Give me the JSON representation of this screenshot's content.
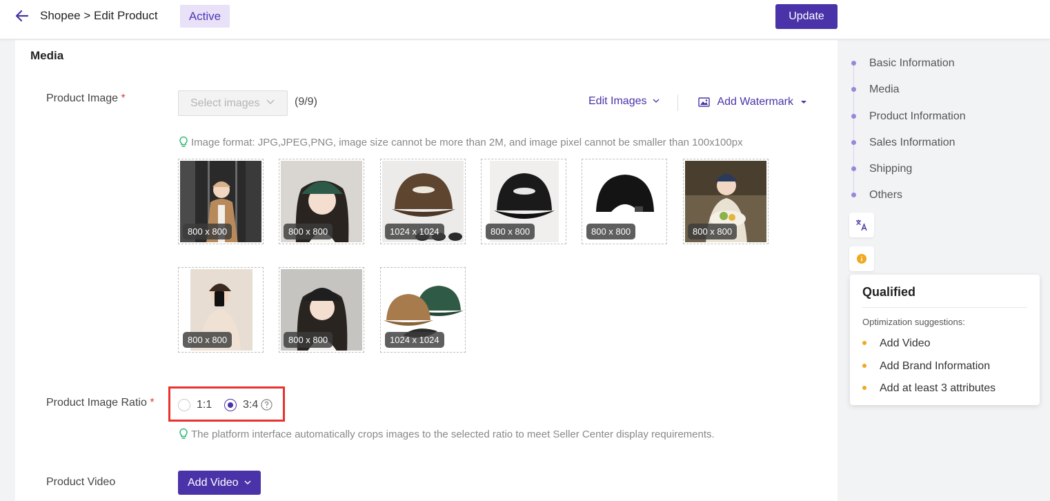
{
  "header": {
    "breadcrumb": "Shopee > Edit Product",
    "status": "Active",
    "update_label": "Update"
  },
  "media": {
    "section_title": "Media",
    "product_image_label": "Product Image",
    "required_mark": "*",
    "select_images_placeholder": "Select images",
    "image_count": "(9/9)",
    "edit_images_label": "Edit Images",
    "add_watermark_label": "Add Watermark",
    "format_hint": "Image format: JPG,JPEG,PNG, image size cannot be more than 2M, and image pixel cannot be smaller than 100x100px",
    "images": [
      {
        "size": "800 x 800",
        "subject": "woman-in-cap-mirror-selfie"
      },
      {
        "size": "800 x 800",
        "subject": "woman-in-green-cap"
      },
      {
        "size": "1024 x 1024",
        "subject": "brown-cap-product"
      },
      {
        "size": "800 x 800",
        "subject": "black-cap-front"
      },
      {
        "size": "800 x 800",
        "subject": "black-cap-back"
      },
      {
        "size": "800 x 800",
        "subject": "woman-in-navy-cap-eating"
      },
      {
        "size": "800 x 800",
        "subject": "person-in-cap-selfie"
      },
      {
        "size": "800 x 800",
        "subject": "woman-in-black-cap"
      },
      {
        "size": "1024 x 1024",
        "subject": "green-and-tan-caps"
      }
    ],
    "ratio_label": "Product Image Ratio",
    "ratio_options": [
      "1:1",
      "3:4"
    ],
    "ratio_selected": "3:4",
    "ratio_hint": "The platform interface automatically crops images to the selected ratio to meet Seller Center display requirements.",
    "video_label": "Product Video",
    "add_video_label": "Add Video"
  },
  "side_nav": {
    "items": [
      "Basic Information",
      "Media",
      "Product Information",
      "Sales Information",
      "Shipping",
      "Others"
    ]
  },
  "qualified": {
    "title": "Qualified",
    "subtitle": "Optimization suggestions:",
    "suggestions": [
      "Add Video",
      "Add Brand Information",
      "Add at least 3 attributes"
    ]
  },
  "colors": {
    "accent": "#4a33a8",
    "badge_bg": "#e8e1f8",
    "highlight_border": "#e8322e",
    "hint_icon": "#2bb673",
    "suggestion_dot": "#f0a81e"
  }
}
